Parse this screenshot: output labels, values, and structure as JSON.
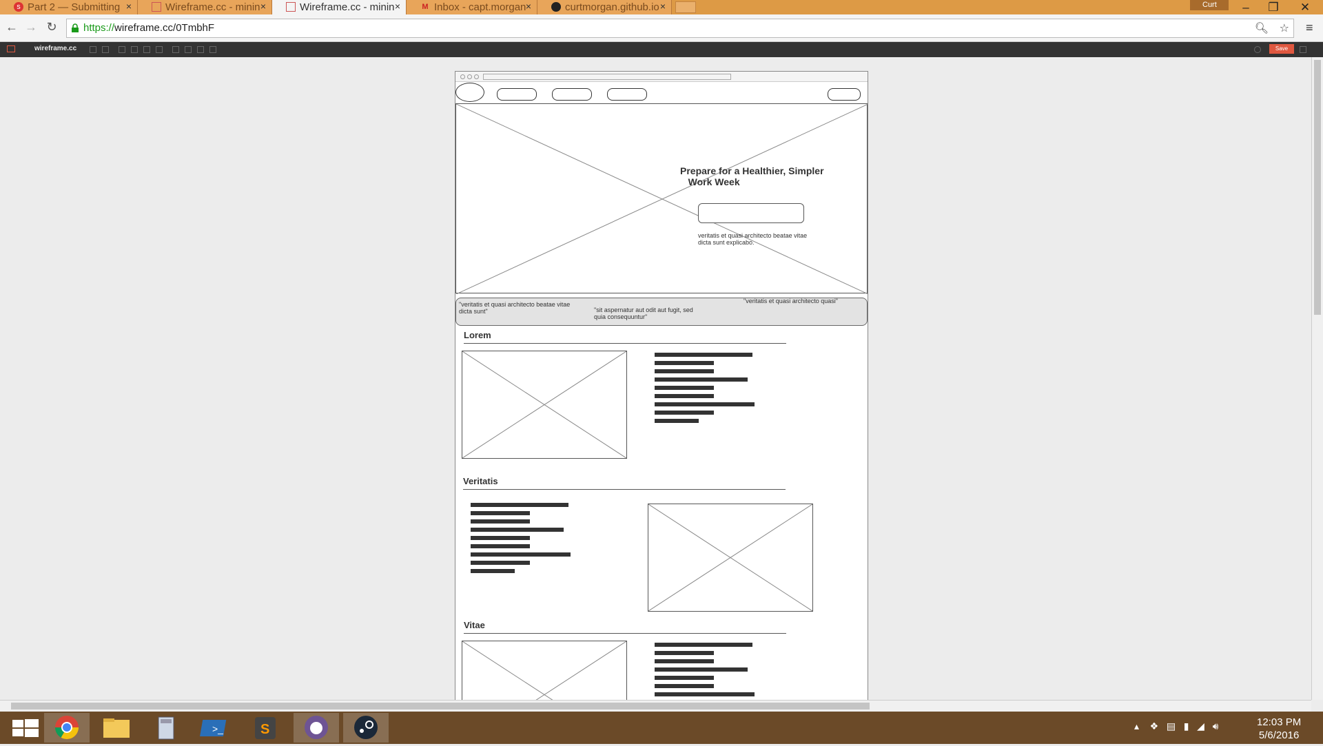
{
  "browser": {
    "tabs": [
      {
        "label": "Part 2 — Submitting",
        "icon": "s"
      },
      {
        "label": "Wireframe.cc - minin",
        "icon": "w"
      },
      {
        "label": "Wireframe.cc - minin",
        "icon": "w"
      },
      {
        "label": "Inbox - capt.morgan",
        "icon": "M"
      },
      {
        "label": "curtmorgan.github.io",
        "icon": "gh"
      }
    ],
    "user": "Curt",
    "url_scheme": "https://",
    "url_rest": "wireframe.cc/0TmbhF"
  },
  "toolbar": {
    "logo": "wireframe.cc",
    "save_label": "Save"
  },
  "wireframe": {
    "hero_title": "Prepare for a Healthier, Simpler\n   Work Week",
    "hero_text": "veritatis et quasi architecto beatae vitae dicta sunt explicabo.",
    "quotes": [
      "\"veritatis et quasi architecto beatae vitae dicta sunt\"",
      "\"sit aspernatur aut odit aut fugit, sed quia consequuntur\"",
      "\"veritatis et quasi architecto quasi\""
    ],
    "sections": [
      {
        "title": "Lorem"
      },
      {
        "title": "Veritatis"
      },
      {
        "title": "Vitae"
      }
    ]
  },
  "taskbar": {
    "time": "12:03 PM",
    "date": "5/6/2016"
  },
  "colors": {
    "tabbar": "#dd9a45",
    "taskbar": "#6b4a28",
    "save": "#e05840"
  }
}
